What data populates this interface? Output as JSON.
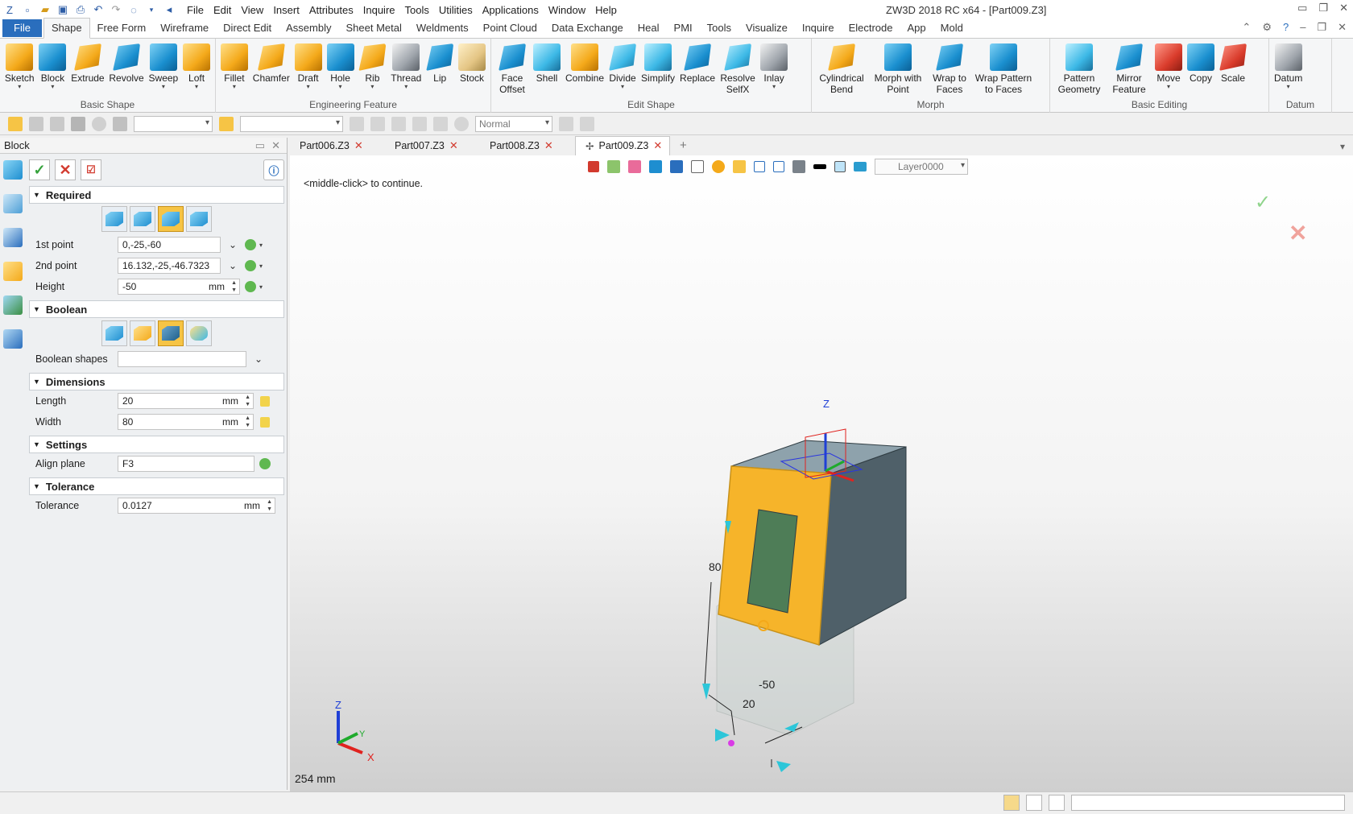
{
  "window": {
    "title": "ZW3D 2018 RC x64 - [Part009.Z3]"
  },
  "menu": [
    "File",
    "Edit",
    "View",
    "Insert",
    "Attributes",
    "Inquire",
    "Tools",
    "Utilities",
    "Applications",
    "Window",
    "Help"
  ],
  "ribbon_tabs": [
    "File",
    "Shape",
    "Free Form",
    "Wireframe",
    "Direct Edit",
    "Assembly",
    "Sheet Metal",
    "Weldments",
    "Point Cloud",
    "Data Exchange",
    "Heal",
    "PMI",
    "Tools",
    "Visualize",
    "Inquire",
    "Electrode",
    "App",
    "Mold"
  ],
  "ribbon_active_tab": "Shape",
  "ribbon_groups": [
    {
      "label": "Basic Shape",
      "buttons": [
        "Sketch",
        "Block",
        "Extrude",
        "Revolve",
        "Sweep",
        "Loft"
      ]
    },
    {
      "label": "Engineering Feature",
      "buttons": [
        "Fillet",
        "Chamfer",
        "Draft",
        "Hole",
        "Rib",
        "Thread",
        "Lip",
        "Stock"
      ]
    },
    {
      "label": "Edit Shape",
      "buttons": [
        "Face Offset",
        "Shell",
        "Combine",
        "Divide",
        "Simplify",
        "Replace",
        "Resolve SelfX",
        "Inlay"
      ]
    },
    {
      "label": "Morph",
      "buttons": [
        "Cylindrical Bend",
        "Morph with Point",
        "Wrap to Faces",
        "Wrap Pattern to Faces"
      ]
    },
    {
      "label": "Basic Editing",
      "buttons": [
        "Pattern Geometry",
        "Mirror Feature",
        "Move",
        "Copy",
        "Scale"
      ]
    },
    {
      "label": "Datum",
      "buttons": [
        "Datum"
      ]
    }
  ],
  "toolbar2": {
    "render_mode": "Normal"
  },
  "panel": {
    "title": "Block",
    "sections": {
      "required": "Required",
      "boolean": "Boolean",
      "dimensions": "Dimensions",
      "settings": "Settings",
      "tolerance": "Tolerance"
    },
    "first_point": {
      "label": "1st point",
      "value": "0,-25,-60"
    },
    "second_point": {
      "label": "2nd point",
      "value": "16.132,-25,-46.7323"
    },
    "height": {
      "label": "Height",
      "value": "-50",
      "unit": "mm"
    },
    "boolean_shapes": {
      "label": "Boolean shapes",
      "value": ""
    },
    "length": {
      "label": "Length",
      "value": "20",
      "unit": "mm"
    },
    "width": {
      "label": "Width",
      "value": "80",
      "unit": "mm"
    },
    "align_plane": {
      "label": "Align plane",
      "value": "F3"
    },
    "tolerance": {
      "label": "Tolerance",
      "value": "0.0127",
      "unit": "mm"
    }
  },
  "doc_tabs": [
    "Part006.Z3",
    "Part007.Z3",
    "Part008.Z3",
    "Part009.Z3"
  ],
  "active_doc": "Part009.Z3",
  "viewport": {
    "layer": "Layer0000",
    "prompt": "<middle-click> to continue.",
    "scale_label": "254 mm",
    "dim_labels": {
      "width": "80",
      "height": "-50",
      "length": "20"
    },
    "axes": {
      "z": "Z",
      "y": "Y",
      "x": "X"
    }
  },
  "colors": {
    "accent": "#2a6ebd",
    "selected": "#f6b42a",
    "solid": "#4f6069"
  }
}
